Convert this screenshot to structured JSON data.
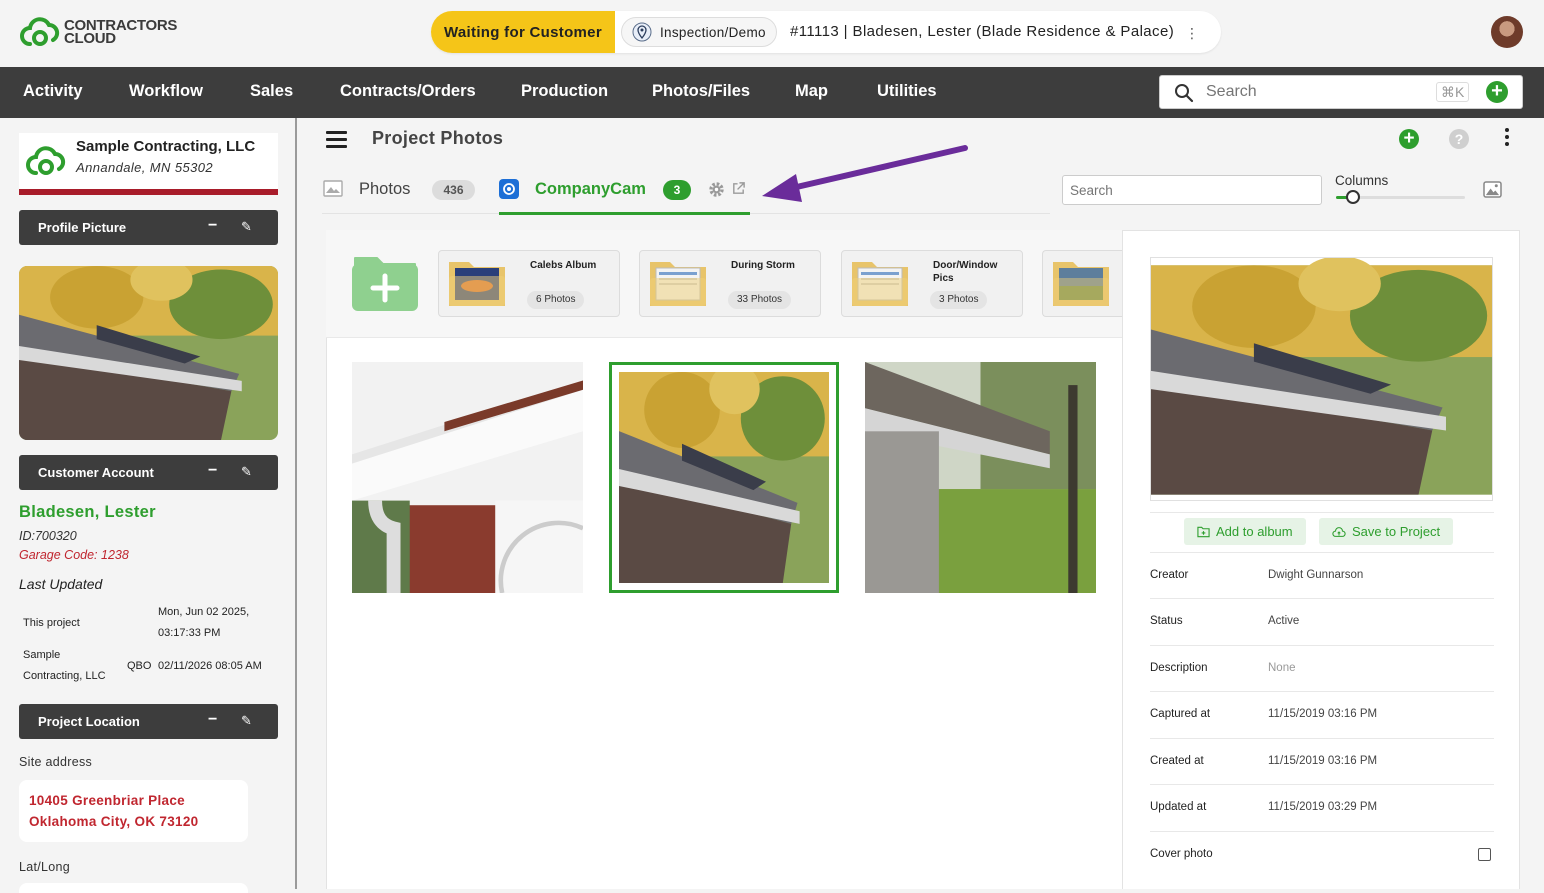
{
  "header": {
    "logo_line1": "CONTRACTORS",
    "logo_line2": "CLOUD",
    "status": "Waiting for Customer",
    "stage": "Inspection/Demo",
    "job_title": "#11113 | Bladesen, Lester (Blade Residence & Palace)",
    "more_glyph": "⋮"
  },
  "nav": {
    "items": [
      "Activity",
      "Workflow",
      "Sales",
      "Contracts/Orders",
      "Production",
      "Photos/Files",
      "Map",
      "Utilities"
    ],
    "search_placeholder": "Search",
    "shortcut": "⌘K"
  },
  "sidebar": {
    "company_name": "Sample Contracting, LLC",
    "company_location": "Annandale, MN 55302",
    "profile_picture_title": "Profile Picture",
    "customer_account_title": "Customer Account",
    "customer_name": "Bladesen, Lester",
    "customer_id": "ID:700320",
    "garage_code": "Garage Code: 1238",
    "last_updated_label": "Last Updated",
    "this_project_label": "This project",
    "this_project_date": "Mon, Jun 02 2025,",
    "this_project_time": "03:17:33 PM",
    "company_row_label_1": "Sample",
    "company_row_label_2": "Contracting, LLC",
    "company_row_source": "QBO",
    "company_row_date": "02/11/2026 08:05 AM",
    "project_location_title": "Project Location",
    "site_address_label": "Site address",
    "address_line1": "10405 Greenbriar Place",
    "address_line2": "Oklahoma City, OK 73120",
    "latlong_label": "Lat/Long"
  },
  "main": {
    "title": "Project Photos",
    "tabs": [
      {
        "label": "Photos",
        "count": "436"
      },
      {
        "label": "CompanyCam",
        "count": "3"
      }
    ],
    "search_placeholder": "Search",
    "columns_label": "Columns",
    "columns_value": 0.1,
    "albums": [
      {
        "name": "Calebs Album",
        "count": "6 Photos"
      },
      {
        "name": "During Storm",
        "count": "33 Photos"
      },
      {
        "name": "Door/Window Pics",
        "count": "3 Photos"
      }
    ]
  },
  "details": {
    "add_to_album": "Add to album",
    "save_to_project": "Save to Project",
    "rows": [
      {
        "key": "Creator",
        "value": "Dwight Gunnarson"
      },
      {
        "key": "Status",
        "value": "Active"
      },
      {
        "key": "Description",
        "value": "None"
      },
      {
        "key": "Captured at",
        "value": "11/15/2019 03:16 PM"
      },
      {
        "key": "Created at",
        "value": "11/15/2019 03:16 PM"
      },
      {
        "key": "Updated at",
        "value": "11/15/2019 03:29 PM"
      }
    ],
    "cover_photo_label": "Cover photo"
  },
  "colors": {
    "accent_green": "#2e9e2e",
    "status_yellow": "#f5c518",
    "nav_dark": "#3d3d3d",
    "alert_red": "#c0262f",
    "annotation_purple": "#6a2c9a"
  }
}
